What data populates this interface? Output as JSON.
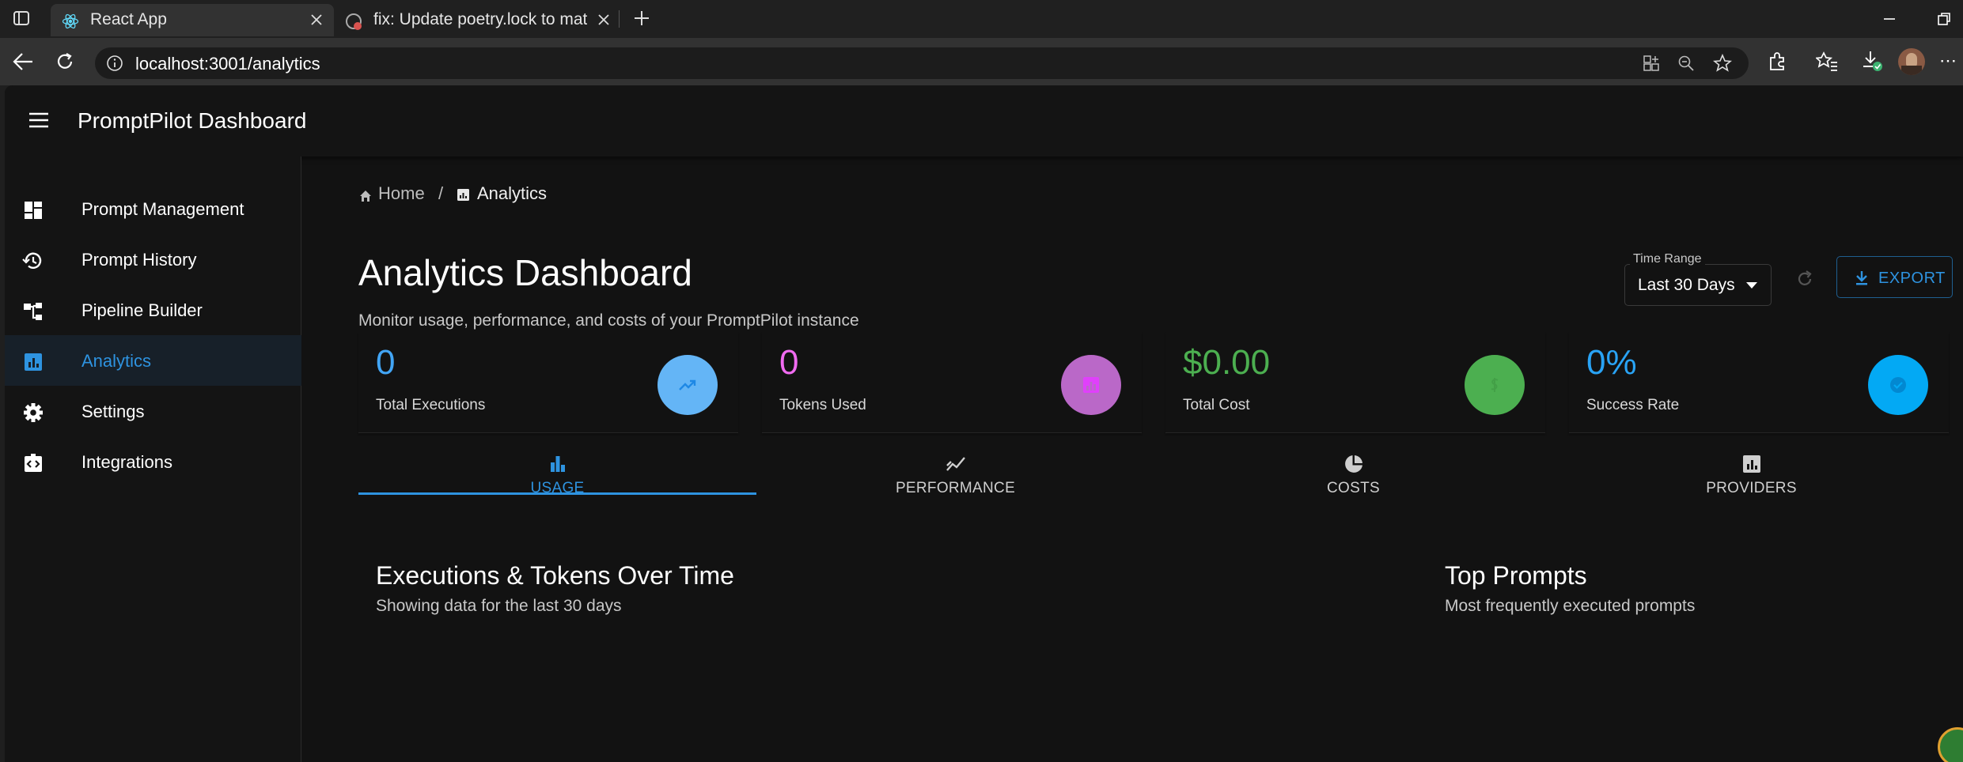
{
  "browser": {
    "tabs": [
      {
        "title": "React App"
      },
      {
        "title": "fix: Update poetry.lock to match p"
      }
    ],
    "url": "localhost:3001/analytics"
  },
  "app": {
    "title": "PromptPilot Dashboard",
    "nav": [
      {
        "label": "Prompt Management",
        "icon": "dashboard-icon"
      },
      {
        "label": "Prompt History",
        "icon": "history-icon"
      },
      {
        "label": "Pipeline Builder",
        "icon": "account-tree-icon"
      },
      {
        "label": "Analytics",
        "icon": "analytics-icon",
        "selected": true
      },
      {
        "label": "Settings",
        "icon": "gear-icon"
      },
      {
        "label": "Integrations",
        "icon": "integration-icon"
      }
    ]
  },
  "breadcrumb": {
    "home": "Home",
    "separator": "/",
    "current": "Analytics"
  },
  "page": {
    "title": "Analytics Dashboard",
    "subtitle": "Monitor usage, performance, and costs of your PromptPilot instance"
  },
  "controls": {
    "time_range_label": "Time Range",
    "time_range_value": "Last 30 Days",
    "export_label": "EXPORT"
  },
  "stats": [
    {
      "value": "0",
      "label": "Total Executions",
      "color": "#42a5f5",
      "circle": "#64b5f6",
      "icon": "trending-up-icon"
    },
    {
      "value": "0",
      "label": "Tokens Used",
      "color": "#f06bf0",
      "circle": "#ba68c8",
      "icon": "token-icon"
    },
    {
      "value": "$0.00",
      "label": "Total Cost",
      "color": "#4caf50",
      "circle": "#4caf50",
      "icon": "money-icon"
    },
    {
      "value": "0%",
      "label": "Success Rate",
      "color": "#29a3f5",
      "circle": "#03a9f4",
      "icon": "check-circle-icon"
    }
  ],
  "tabs": [
    {
      "label": "USAGE",
      "icon": "bar-chart-icon",
      "selected": true
    },
    {
      "label": "PERFORMANCE",
      "icon": "line-chart-icon"
    },
    {
      "label": "COSTS",
      "icon": "pie-chart-icon"
    },
    {
      "label": "PROVIDERS",
      "icon": "assessment-icon"
    }
  ],
  "sections": {
    "chart_title": "Executions & Tokens Over Time",
    "chart_subtitle": "Showing data for the last 30 days",
    "top_title": "Top Prompts",
    "top_subtitle": "Most frequently executed prompts"
  }
}
